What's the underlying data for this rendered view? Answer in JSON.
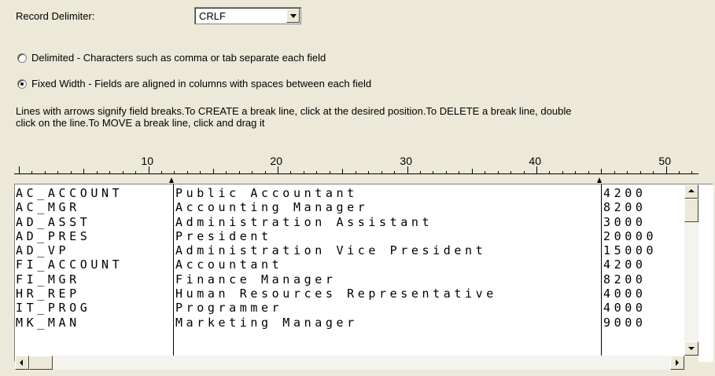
{
  "record_delimiter": {
    "label": "Record Delimiter:",
    "value": "CRLF"
  },
  "options": {
    "delimited": "Delimited - Characters such as comma or tab separate each field",
    "fixed_width": "Fixed Width - Fields are aligned in columns with spaces between each field",
    "selected": "fixed_width"
  },
  "instructions": {
    "line1": "Lines with arrows signify field breaks.To CREATE a break line, click at the desired position.To DELETE a break line, double",
    "line2": "click on the line.To MOVE a break line, click and drag it"
  },
  "ruler": {
    "labels": [
      "10",
      "20",
      "30",
      "40",
      "50"
    ]
  },
  "rows": [
    {
      "code": "AC_ACCOUNT",
      "title": "Public Accountant",
      "salary": "4200"
    },
    {
      "code": "AC_MGR",
      "title": "Accounting Manager",
      "salary": "8200"
    },
    {
      "code": "AD_ASST",
      "title": "Administration Assistant",
      "salary": "3000"
    },
    {
      "code": "AD_PRES",
      "title": "President",
      "salary": "20000"
    },
    {
      "code": "AD_VP",
      "title": "Administration Vice President",
      "salary": "15000"
    },
    {
      "code": "FI_ACCOUNT",
      "title": "Accountant",
      "salary": "4200"
    },
    {
      "code": "FI_MGR",
      "title": "Finance Manager",
      "salary": "8200"
    },
    {
      "code": "HR_REP",
      "title": "Human Resources Representative",
      "salary": "4000"
    },
    {
      "code": "IT_PROG",
      "title": "Programmer",
      "salary": "4000"
    },
    {
      "code": "MK_MAN",
      "title": "Marketing Manager",
      "salary": "9000"
    }
  ],
  "icons": {
    "dropdown": "chevron-down-icon",
    "scroll_up": "scroll-up-arrow-icon",
    "scroll_down": "scroll-down-arrow-icon",
    "scroll_left": "scroll-left-arrow-icon",
    "scroll_right": "scroll-right-arrow-icon",
    "break_marker": "break-arrow-icon"
  }
}
